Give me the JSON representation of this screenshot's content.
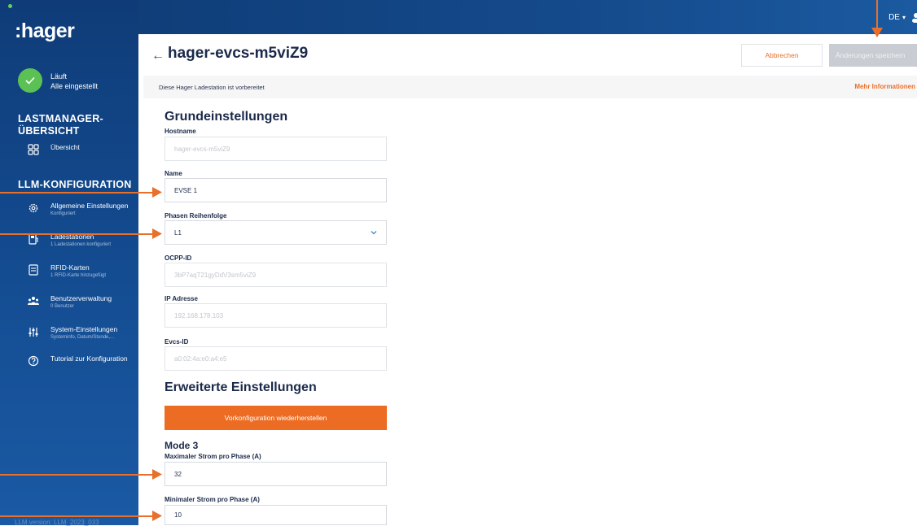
{
  "app": {
    "logo": ":hager",
    "status": {
      "line1": "Läuft",
      "line2": "Alle eingestellt"
    },
    "version": "LLM version: LLM_2023_033"
  },
  "topbar": {
    "language": "DE"
  },
  "sidebar": {
    "section1": "LASTMANAGER-\nÜBERSICHT",
    "overview": {
      "label": "Übersicht",
      "icon": "grid-icon"
    },
    "section2": "LLM-KONFIGURATION",
    "items": [
      {
        "label": "Allgemeine Einstellungen",
        "sub": "Konfiguriert",
        "icon": "gear-icon"
      },
      {
        "label": "Ladestationen",
        "sub": "1 Ladestationen konfiguriert",
        "icon": "charging-station-icon"
      },
      {
        "label": "RFID-Karten",
        "sub": "1 RFID-Karte hinzugefügt",
        "icon": "rfid-card-icon"
      },
      {
        "label": "Benutzerverwaltung",
        "sub": "0 Benutzer",
        "icon": "users-icon"
      },
      {
        "label": "System-Einstellungen",
        "sub": "Systeminfo, Datum/Stunde,...",
        "icon": "sliders-icon"
      },
      {
        "label": "Tutorial zur Konfiguration",
        "sub": "",
        "icon": "help-circle-icon"
      }
    ]
  },
  "header": {
    "title": "hager-evcs-m5viZ9",
    "cancel": "Abbrechen",
    "save": "Änderungen speichern"
  },
  "infobar": {
    "text": "Diese Hager Ladestation ist vorbereitet",
    "link": "Mehr Informationen"
  },
  "form": {
    "basic_title": "Grundeinstellungen",
    "hostname": {
      "label": "Hostname",
      "value": "hager-evcs-m5viZ9"
    },
    "name": {
      "label": "Name",
      "value": "EVSE 1"
    },
    "phase_order": {
      "label": "Phasen Reihenfolge",
      "value": "L1"
    },
    "ocpp_id": {
      "label": "OCPP-ID",
      "value": "3bP7aqT21gyDdV3sm5viZ9"
    },
    "ip": {
      "label": "IP Adresse",
      "value": "192.168.178.103"
    },
    "evcs_id": {
      "label": "Evcs-ID",
      "value": "a0:02:4a:e0:a4:e5"
    },
    "advanced_title": "Erweiterte Einstellungen",
    "restore_button": "Vorkonfiguration wiederherstellen",
    "mode_title": "Mode 3",
    "max_current": {
      "label": "Maximaler Strom pro Phase (A)",
      "value": "32"
    },
    "min_current": {
      "label": "Minimaler Strom pro Phase (A)",
      "value": "10"
    }
  },
  "colors": {
    "accent": "#e8702a",
    "sidebar": "#134a8e",
    "status_ok": "#5cc154",
    "save_disabled": "#c9ccd2"
  }
}
